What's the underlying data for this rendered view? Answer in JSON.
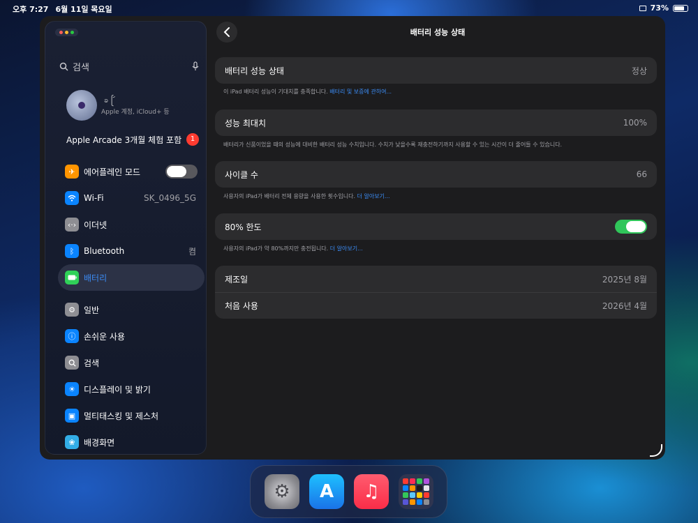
{
  "status": {
    "time": "오후 7:27",
    "date": "6월 11일 목요일",
    "battery": "73%"
  },
  "sidebar": {
    "search_label": "검색",
    "profile": {
      "name": "ခ ᩕ ᩢ",
      "subtitle": "Apple 계정, iCloud+ 등"
    },
    "arcade": {
      "label": "Apple Arcade 3개월 체험 포함",
      "badge": "1"
    },
    "items": [
      {
        "label": "에어플레인 모드",
        "icon": "airplane-icon",
        "color": "#ff9500",
        "toggle": "off"
      },
      {
        "label": "Wi-Fi",
        "icon": "wifi-icon",
        "color": "#0a84ff",
        "value": "SK_0496_5G"
      },
      {
        "label": "이더넷",
        "icon": "ethernet-icon",
        "color": "#8e8e93"
      },
      {
        "label": "Bluetooth",
        "icon": "bluetooth-icon",
        "color": "#0a84ff",
        "value": "켬"
      },
      {
        "label": "배터리",
        "icon": "battery-icon",
        "color": "#30d158",
        "active": true
      },
      {
        "label": "일반",
        "icon": "gear-icon",
        "color": "#8e8e93"
      },
      {
        "label": "손쉬운 사용",
        "icon": "accessibility-icon",
        "color": "#0a84ff"
      },
      {
        "label": "검색",
        "icon": "search-icon",
        "color": "#8e8e93"
      },
      {
        "label": "디스플레이 및 밝기",
        "icon": "sun-icon",
        "color": "#0a84ff"
      },
      {
        "label": "멀티태스킹 및 제스처",
        "icon": "multitasking-icon",
        "color": "#0a84ff"
      },
      {
        "label": "배경화면",
        "icon": "flower-icon",
        "color": "#32ade6"
      }
    ]
  },
  "detail": {
    "title": "배터리 성능 상태",
    "health": {
      "label": "배터리 성능 상태",
      "value": "정상",
      "note": "이 iPad 배터리 성능이 기대치를 충족합니다. ",
      "link": "배터리 및 보증에 관하여..."
    },
    "max_capacity": {
      "label": "성능 최대치",
      "value": "100%",
      "note": "배터리가 신품이었을 때의 성능에 대비한 배터리 성능 수치입니다. 수치가 낮을수록 재충전하기까지 사용할 수 있는 시간이 더 줄어들 수 있습니다."
    },
    "cycle": {
      "label": "사이클 수",
      "value": "66",
      "note": "사용자의 iPad가 배터리 전체 용량을 사용한 횟수입니다. ",
      "link": "더 알아보기..."
    },
    "limit": {
      "label": "80% 한도",
      "toggle": "on",
      "note": "사용자의 iPad가 약 80%까지만 충전됩니다. ",
      "link": "더 알아보기..."
    },
    "manufacture": {
      "label": "제조일",
      "value": "2025년 8월"
    },
    "first_use": {
      "label": "처음 사용",
      "value": "2026년 4월"
    }
  },
  "dock": {
    "apps": [
      "settings-app-icon",
      "app-store-icon",
      "music-app-icon",
      "app-folder-icon"
    ]
  }
}
